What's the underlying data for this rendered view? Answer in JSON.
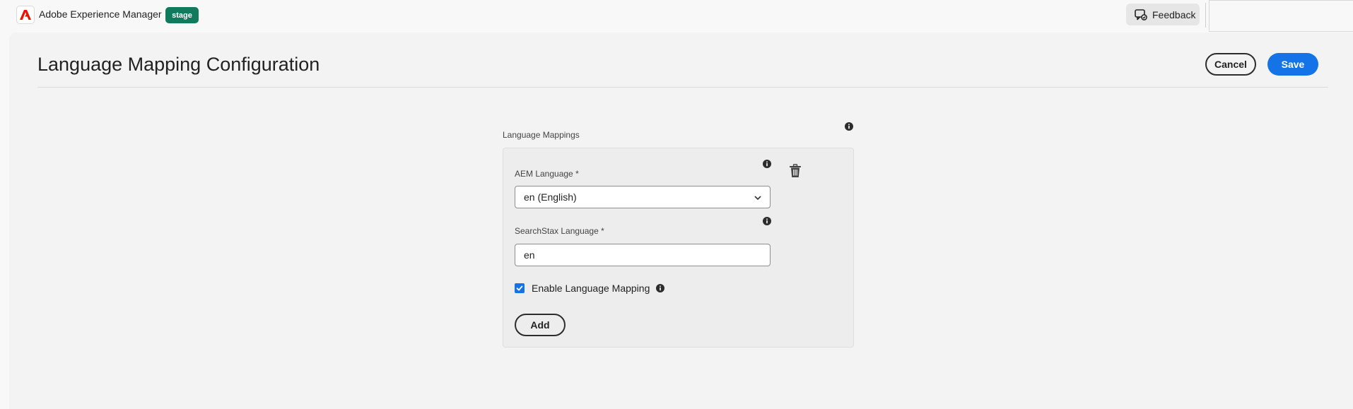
{
  "app": {
    "title": "Adobe Experience Manager",
    "environment_badge": "stage",
    "brand_color": "#eb1000",
    "badge_color": "#0f7a5c"
  },
  "header": {
    "feedback_label": "Feedback",
    "feedback_icon": "feedback-bubble-icon"
  },
  "page": {
    "title": "Language Mapping Configuration",
    "cancel_label": "Cancel",
    "save_label": "Save",
    "accent_color": "#1473e6"
  },
  "form": {
    "section_label": "Language Mappings",
    "mapping": {
      "aem_language_label": "AEM Language *",
      "aem_language_value": "en (English)",
      "searchstax_language_label": "SearchStax Language *",
      "searchstax_language_value": "en",
      "enable_label": "Enable Language Mapping",
      "enable_checked": true,
      "delete_icon": "trash-icon"
    },
    "add_label": "Add"
  }
}
